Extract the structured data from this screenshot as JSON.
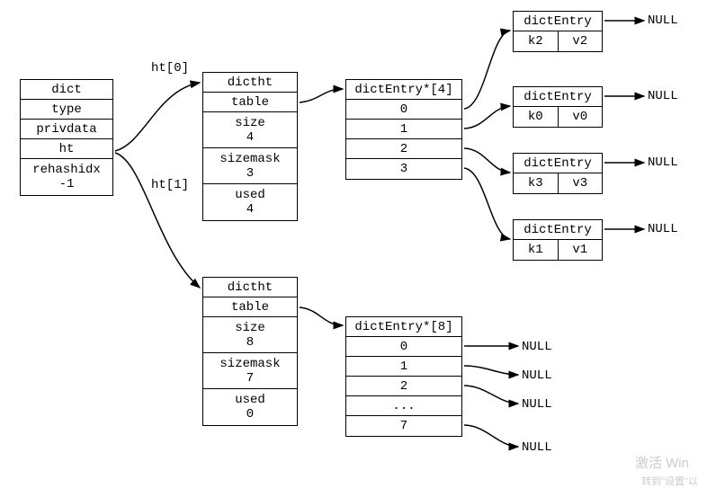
{
  "dict": {
    "title": "dict",
    "fields": [
      "type",
      "privdata",
      "ht"
    ],
    "rehash_label": "rehashidx",
    "rehash_value": "-1"
  },
  "ht_labels": [
    "ht[0]",
    "ht[1]"
  ],
  "dictht0": {
    "title": "dictht",
    "table_label": "table",
    "size_label": "size",
    "size_value": "4",
    "sizemask_label": "sizemask",
    "sizemask_value": "3",
    "used_label": "used",
    "used_value": "4"
  },
  "dictht1": {
    "title": "dictht",
    "table_label": "table",
    "size_label": "size",
    "size_value": "8",
    "sizemask_label": "sizemask",
    "sizemask_value": "7",
    "used_label": "used",
    "used_value": "0"
  },
  "bucket0": {
    "header": "dictEntry*[4]",
    "rows": [
      "0",
      "1",
      "2",
      "3"
    ]
  },
  "bucket1": {
    "header": "dictEntry*[8]",
    "rows": [
      "0",
      "1",
      "2",
      "...",
      "7"
    ]
  },
  "entries": [
    {
      "title": "dictEntry",
      "k": "k2",
      "v": "v2"
    },
    {
      "title": "dictEntry",
      "k": "k0",
      "v": "v0"
    },
    {
      "title": "dictEntry",
      "k": "k3",
      "v": "v3"
    },
    {
      "title": "dictEntry",
      "k": "k1",
      "v": "v1"
    }
  ],
  "null_label": "NULL",
  "watermark1": "激活 Win",
  "watermark2": "转到\"设置\"以"
}
